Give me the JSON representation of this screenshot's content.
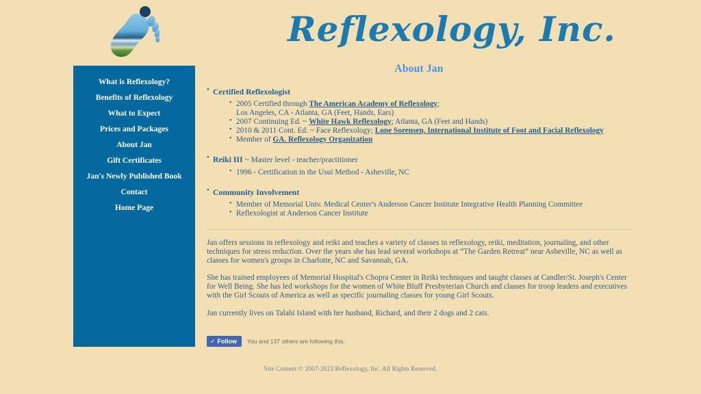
{
  "site": {
    "title": "Reflexology, Inc.",
    "logo_icon": "footprint-beach-logo",
    "accent_blue": "#0569a0",
    "background": "#f3dfb4",
    "heading_blue": "#4a90e2",
    "text_blue": "#2b5c8a"
  },
  "sidebar": {
    "items": [
      {
        "label": "What is Reflexology?"
      },
      {
        "label": "Benefits of Reflexology"
      },
      {
        "label": "What to Expect"
      },
      {
        "label": "Prices and Packages"
      },
      {
        "label": "About Jan"
      },
      {
        "label": "Gift Certificates"
      },
      {
        "label": "Jan's Newly Published Book"
      },
      {
        "label": "Contact"
      },
      {
        "label": "Home Page"
      }
    ]
  },
  "main": {
    "heading": "About Jan",
    "sections": [
      {
        "title": "Certified Reflexologist",
        "title_suffix": "",
        "items": [
          {
            "pre": "2005 Certified through ",
            "link": "The American Academy of Reflexology",
            "post": ";",
            "line2": "Los Angeles, CA - Atlanta, GA (Feet, Hands, Ears)"
          },
          {
            "pre": "2007 Continuing Ed. ~ ",
            "link": "White Hawk Reflexology",
            "post": "; Atlanta, GA (Feet and Hands)",
            "line2": ""
          },
          {
            "pre": "2010 & 2011 Cont. Ed. ~ Face Reflexology; ",
            "link": "Lone Sorensen, International Institute of Foot and Facial Reflexology",
            "post": "",
            "line2": ""
          },
          {
            "pre": "Member of ",
            "link": "GA. Reflexology Organization",
            "post": "",
            "line2": ""
          }
        ]
      },
      {
        "title": "Reiki III",
        "title_suffix": " ~ Master level - teacher/practitioner",
        "items": [
          {
            "pre": "1996 - Certification in the Usui Method - Asheville, NC",
            "link": "",
            "post": "",
            "line2": ""
          }
        ]
      },
      {
        "title": "Community Involvement",
        "title_suffix": "",
        "items": [
          {
            "pre": "Member of Memorial Univ. Medical Center's Anderson Cancer Institute Integrative Health Planning Committee",
            "link": "",
            "post": "",
            "line2": ""
          },
          {
            "pre": "Reflexologist at Anderson Cancer Institute",
            "link": "",
            "post": "",
            "line2": ""
          }
        ]
      }
    ],
    "paragraphs": [
      "Jan offers sessions in reflexology and reiki and teaches a variety of classes in reflexology, reiki, meditation, journaling, and other techniques for stress reduction. Over the years she has lead several workshops at “The Garden Retreat” near Asheville, NC as well as classes for women's groups in Charlotte, NC and Savannah, GA.",
      "She has trained employees of Memorial Hospital's Chopra Center in Reiki techniques and taught classes at Candler/St. Joseph's Center for Well Being. She has led workshops for the women of White Bluff Presbyterian Church and classes for troop leaders and executives with the Girl Scouts of America as well as specific journaling classes for young Girl Scouts.",
      "Jan currently lives on Talahi Island with her husband, Richard, and their 2 dogs and 2 cats."
    ]
  },
  "follow": {
    "button_label": "Follow",
    "check_icon": "check-icon",
    "status_text": "You and 137 others are following this."
  },
  "footer": {
    "text": "Site Content © 2007-2023 Reflexology, Inc. All Rights Reserved."
  }
}
